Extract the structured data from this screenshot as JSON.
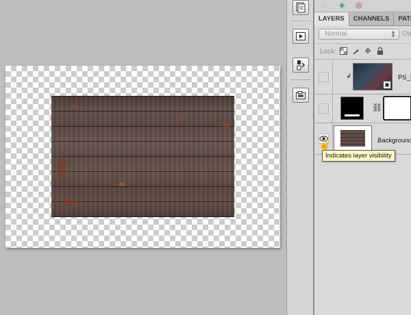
{
  "panel": {
    "tabs": [
      {
        "label": "LAYERS",
        "active": true
      },
      {
        "label": "CHANNELS",
        "active": false
      },
      {
        "label": "PATH",
        "active": false
      }
    ],
    "blend_mode": "Normal",
    "opacity_label": "Opa",
    "lock_label": "Lock:",
    "layers": [
      {
        "name": "PS_Ni",
        "type": "smart-object",
        "visible": false
      },
      {
        "name": "",
        "type": "adjustment-with-mask",
        "visible": false
      },
      {
        "name": "Background",
        "type": "raster",
        "visible": true
      }
    ]
  },
  "tooltip": {
    "text": "Indicates layer visibility"
  },
  "icons": {
    "dock": [
      "layer-comps-icon",
      "actions-icon",
      "swatches-icon",
      "navigator-icon"
    ],
    "top": [
      "selection-icon",
      "mask-icon",
      "color-icon"
    ],
    "lock": [
      "lock-transparent-icon",
      "lock-image-icon",
      "lock-position-icon",
      "lock-all-icon"
    ]
  },
  "colors": {
    "workspace": "#bebebe",
    "panel": "#d9d9d9",
    "tooltip": "#fbfbc8",
    "wood": "#5e4a45"
  }
}
